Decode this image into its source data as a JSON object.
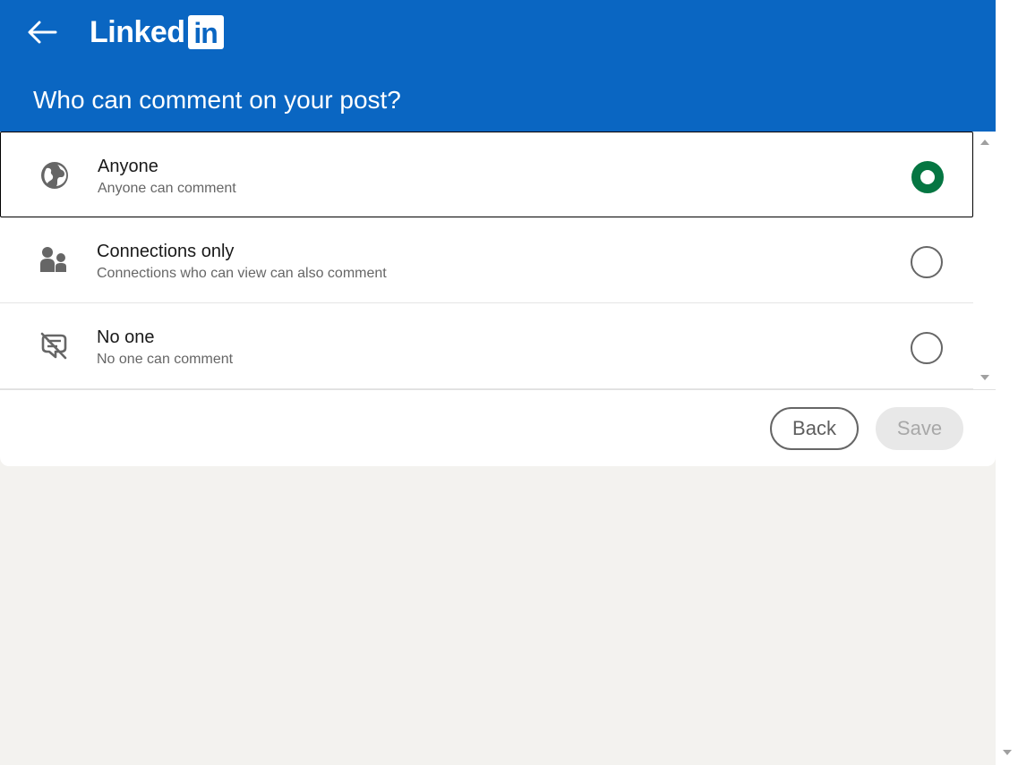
{
  "brand": {
    "logo_text": "Linked",
    "logo_box": "in"
  },
  "header": {
    "title": "Who can comment on your post?"
  },
  "options": [
    {
      "title": "Anyone",
      "description": "Anyone can comment",
      "icon": "globe-icon",
      "selected": true
    },
    {
      "title": "Connections only",
      "description": "Connections who can view can also comment",
      "icon": "people-icon",
      "selected": false
    },
    {
      "title": "No one",
      "description": "No one can comment",
      "icon": "comment-off-icon",
      "selected": false
    }
  ],
  "footer": {
    "back_label": "Back",
    "save_label": "Save"
  },
  "colors": {
    "header_bg": "#0a66c2",
    "radio_selected": "#057642",
    "page_bg": "#f3f2ef"
  }
}
